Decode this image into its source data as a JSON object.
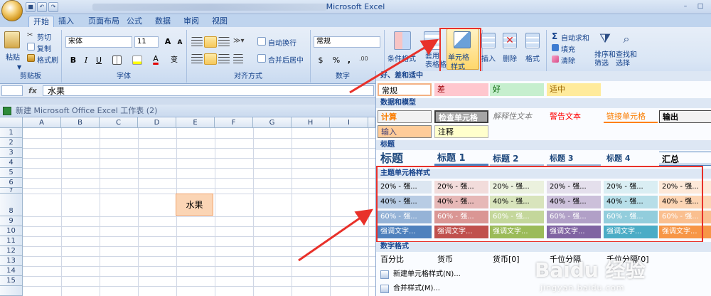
{
  "window": {
    "title": "Microsoft Excel"
  },
  "tabs": [
    "开始",
    "插入",
    "页面布局",
    "公式",
    "数据",
    "审阅",
    "视图"
  ],
  "clipboard": {
    "paste": "粘贴",
    "cut": "剪切",
    "copy": "复制",
    "format_painter": "格式刷",
    "group": "剪贴板"
  },
  "font": {
    "name": "宋体",
    "size": "11",
    "bold": "B",
    "italic": "I",
    "underline": "U",
    "grow": "A",
    "shrink": "A",
    "change_case": "变",
    "font_color_letter": "A",
    "group": "字体"
  },
  "alignment": {
    "wrap_text": "自动换行",
    "merge_center": "合并后居中",
    "group": "对齐方式"
  },
  "number": {
    "format": "常规",
    "currency": "$",
    "percent": "%",
    "comma": ",",
    "group": "数字"
  },
  "styles": {
    "conditional": "条件格式",
    "format_as_table": "套用\n表格格式",
    "cell_styles_line1": "单元格",
    "cell_styles_line2": "样式"
  },
  "cells": {
    "insert": "插入",
    "delete": "删除",
    "format": "格式"
  },
  "editing": {
    "autosum": "自动求和",
    "fill": "填充",
    "clear": "清除",
    "sort": "排序和\n筛选",
    "find": "查找和\n选择"
  },
  "formula_bar": {
    "fx": "fx",
    "value": "水果"
  },
  "workbook": {
    "title": "新建 Microsoft Office Excel 工作表 (2)",
    "columns": [
      "A",
      "B",
      "C",
      "D",
      "E",
      "F",
      "G",
      "H",
      "I"
    ],
    "rows": [
      "1",
      "2",
      "3",
      "4",
      "5",
      "6",
      "7",
      "8",
      "9",
      "10",
      "11",
      "12",
      "13",
      "14",
      "15"
    ],
    "cell_E8": "水果"
  },
  "gallery": {
    "sections": {
      "good_bad": "好、差和适中",
      "data_model": "数据和模型",
      "titles": "标题",
      "theme": "主题单元格样式",
      "number": "数字格式"
    },
    "good_bad": [
      "常规",
      "差",
      "好",
      "适中"
    ],
    "data_model_row1": [
      "计算",
      "检查单元格",
      "解释性文本",
      "警告文本",
      "链接单元格",
      "输出"
    ],
    "data_model_row2": [
      "输入",
      "注释"
    ],
    "titles": [
      "标题",
      "标题 1",
      "标题 2",
      "标题 3",
      "标题 4",
      "汇总"
    ],
    "theme_rows": [
      [
        "20% - 强...",
        "20% - 强...",
        "20% - 强...",
        "20% - 强...",
        "20% - 强...",
        "20% - 强..."
      ],
      [
        "40% - 强...",
        "40% - 强...",
        "40% - 强...",
        "40% - 强...",
        "40% - 强...",
        "40% - 强..."
      ],
      [
        "60% - 强...",
        "60% - 强...",
        "60% - 强...",
        "60% - 强...",
        "60% - 强...",
        "60% - 强..."
      ],
      [
        "强调文字...",
        "强调文字...",
        "强调文字...",
        "强调文字...",
        "强调文字...",
        "强调文字..."
      ]
    ],
    "number_formats": [
      "百分比",
      "货币",
      "货币[0]",
      "千位分隔",
      "千位分隔[0]"
    ],
    "new_style": "新建单元格样式(N)...",
    "merge_styles": "合并样式(M)..."
  },
  "watermark": {
    "brand": "Baidu 经验",
    "url": "jingyan.baidu.com"
  },
  "colors": {
    "accent_red": "#e8312a",
    "ribbon_bg": "#dae6f5"
  }
}
